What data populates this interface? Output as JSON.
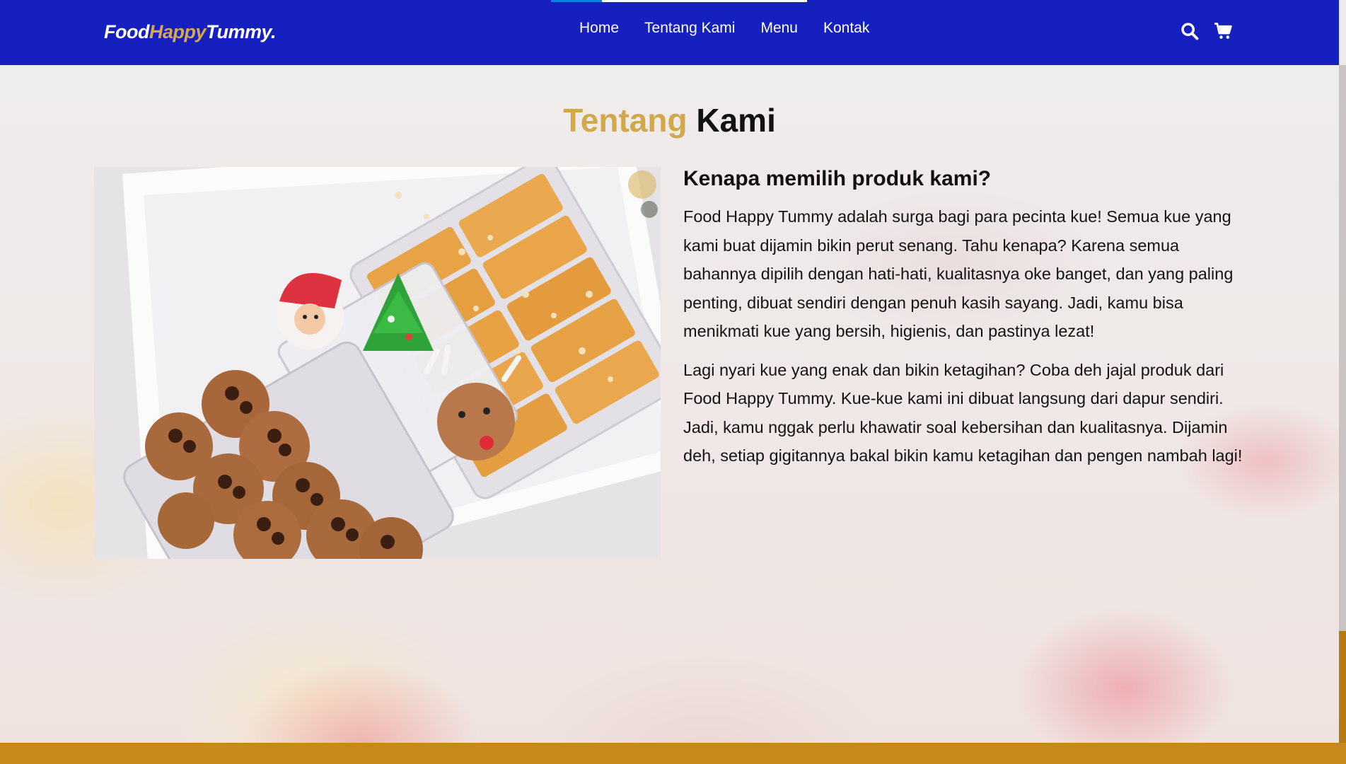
{
  "brand": {
    "logo_part1": "Food",
    "logo_part2": "Happy",
    "logo_part3": "Tummy."
  },
  "nav": {
    "links": [
      "Home",
      "Tentang Kami",
      "Menu",
      "Kontak"
    ],
    "icons": [
      "search-icon",
      "shopping-cart-icon"
    ]
  },
  "about": {
    "title_accent": "Tentang",
    "title_rest": "Kami",
    "heading": "Kenapa memilih produk kami?",
    "paragraphs": [
      "Food Happy Tummy adalah surga bagi para pecinta kue! Semua kue yang kami buat dijamin bikin perut senang. Tahu kenapa? Karena semua bahannya dipilih dengan hati-hati, kualitasnya oke banget, dan yang paling penting, dibuat sendiri dengan penuh kasih sayang. Jadi, kamu bisa menikmati kue yang bersih, higienis, dan pastinya lezat!",
      "Lagi nyari kue yang enak dan bikin ketagihan? Coba deh jajal produk dari Food Happy Tummy. Kue-kue kami ini dibuat langsung dari dapur sendiri. Jadi, kamu nggak perlu khawatir soal kebersihan dan kualitasnya. Dijamin deh, setiap gigitannya bakal bikin kamu ketagihan dan pengen nambah lagi!"
    ]
  },
  "colors": {
    "navbar": "#1520bf",
    "accent_gold": "#d2a84c",
    "footer_strip": "#c8891c",
    "active_tab_indicator": "#0a7fe0"
  }
}
